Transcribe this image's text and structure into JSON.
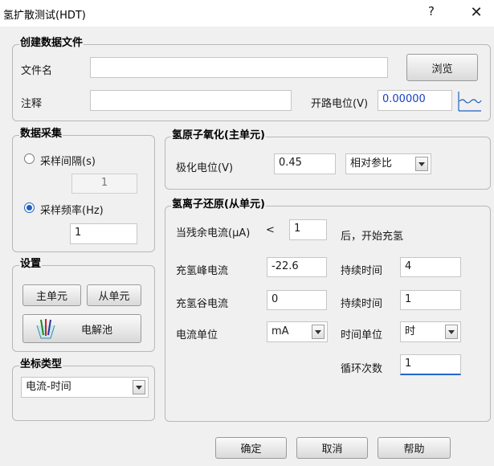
{
  "window": {
    "title": "氢扩散测试(HDT)",
    "help_symbol": "?",
    "close_symbol": "✕"
  },
  "create_file": {
    "legend": "创建数据文件",
    "filename_label": "文件名",
    "filename_value": "",
    "browse_label": "浏览",
    "note_label": "注释",
    "note_value": "",
    "ocp_label": "开路电位(V)",
    "ocp_value": "0.00000"
  },
  "acquisition": {
    "legend": "数据采集",
    "interval_label": "采样间隔(s)",
    "interval_value": "1",
    "frequency_label": "采样频率(Hz)",
    "frequency_value": "1",
    "selected": "frequency"
  },
  "settings": {
    "legend": "设置",
    "main_unit_label": "主单元",
    "slave_unit_label": "从单元",
    "cell_label": "电解池"
  },
  "axis": {
    "legend": "坐标类型",
    "selected": "电流-时间"
  },
  "oxidation": {
    "legend": "氢原子氧化(主单元)",
    "potential_label": "极化电位(V)",
    "potential_value": "0.45",
    "reference_selected": "相对参比"
  },
  "reduction": {
    "legend": "氢离子还原(从单元)",
    "residual_label": "当残余电流(μA)",
    "lt_symbol": "<",
    "residual_value": "1",
    "after_label": "后，开始充氢",
    "peak_label": "充氢峰电流",
    "peak_value": "-22.6",
    "duration1_label": "持续时间",
    "duration1_value": "4",
    "valley_label": "充氢谷电流",
    "valley_value": "0",
    "duration2_label": "持续时间",
    "duration2_value": "1",
    "current_unit_label": "电流单位",
    "current_unit_selected": "mA",
    "time_unit_label": "时间单位",
    "time_unit_selected": "时",
    "cycles_label": "循环次数",
    "cycles_value": "1"
  },
  "footer": {
    "ok_label": "确定",
    "cancel_label": "取消",
    "help_label": "帮助"
  },
  "colors": {
    "accent": "#1f5fbf",
    "background": "#f0f0f0",
    "ocp_text": "#1a40c0"
  },
  "icons": {
    "ocp_chart": "waveform-chart-icon",
    "cell": "electrolytic-cell-icon"
  }
}
